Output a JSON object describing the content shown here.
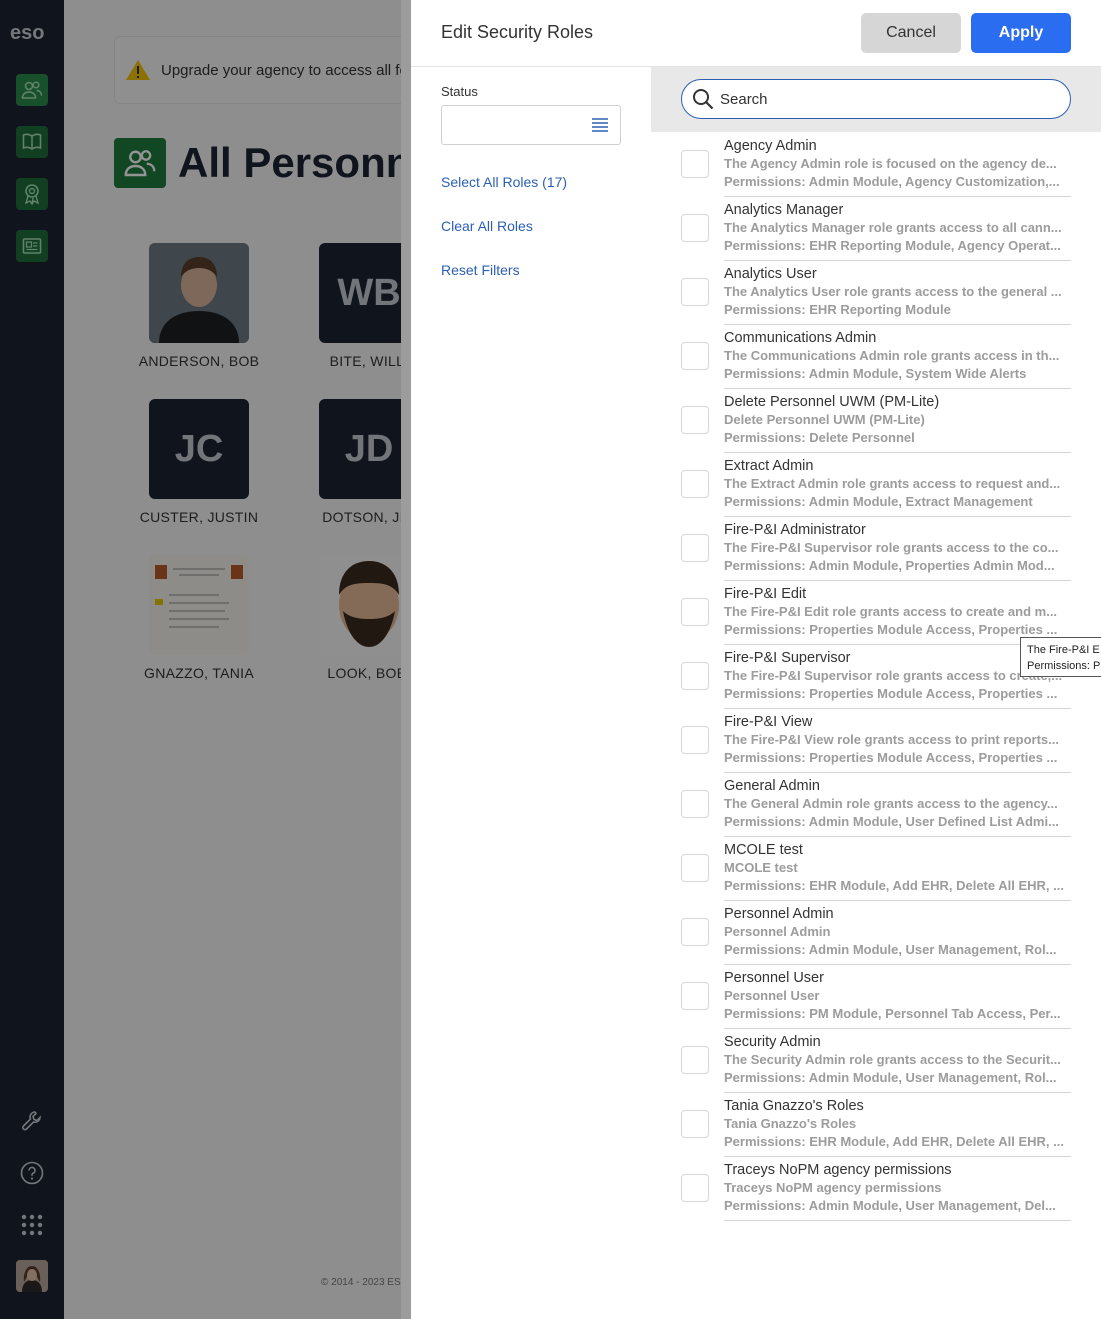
{
  "nav": {
    "logo": "eso",
    "icons": [
      "personnel-icon",
      "book-icon",
      "award-icon",
      "reports-icon"
    ],
    "bottom_icons": [
      "wrench-icon",
      "help-icon",
      "apps-grid-icon"
    ]
  },
  "background": {
    "banner_text": "Upgrade your agency to access all fe",
    "page_title": "All Personn",
    "people": [
      {
        "initials": "",
        "name": "ANDERSON, BOB",
        "photo": true
      },
      {
        "initials": "WB",
        "name": "BITE, WILLI",
        "photo": false
      },
      {
        "initials": "JC",
        "name": "CUSTER, JUSTIN",
        "photo": false
      },
      {
        "initials": "JD",
        "name": "DOTSON, JIM",
        "photo": false
      },
      {
        "initials": "",
        "name": "GNAZZO, TANIA",
        "photo": true
      },
      {
        "initials": "",
        "name": "LOOK, BOBI",
        "photo": true
      }
    ],
    "footer": "© 2014 - 2023 ES"
  },
  "drawer": {
    "title": "Edit Security Roles",
    "cancel_label": "Cancel",
    "apply_label": "Apply",
    "status_label": "Status",
    "select_all_label": "Select All Roles (17)",
    "clear_all_label": "Clear All Roles",
    "reset_filters_label": "Reset Filters",
    "search_placeholder": "Search"
  },
  "roles": [
    {
      "name": "Agency Admin",
      "desc": "The Agency Admin role is focused on the agency de...",
      "perms": "Permissions: Admin Module, Agency Customization,..."
    },
    {
      "name": "Analytics Manager",
      "desc": "The Analytics Manager role grants access to all cann...",
      "perms": "Permissions: EHR Reporting Module, Agency Operat..."
    },
    {
      "name": "Analytics User",
      "desc": "The Analytics User role grants access to the general ...",
      "perms": "Permissions: EHR Reporting Module"
    },
    {
      "name": "Communications Admin",
      "desc": "The Communications Admin role grants access in th...",
      "perms": "Permissions: Admin Module, System Wide Alerts"
    },
    {
      "name": "Delete Personnel UWM (PM-Lite)",
      "desc": "Delete Personnel UWM (PM-Lite)",
      "perms": "Permissions: Delete Personnel"
    },
    {
      "name": "Extract Admin",
      "desc": "The Extract Admin role grants access to request and...",
      "perms": "Permissions: Admin Module, Extract Management"
    },
    {
      "name": "Fire-P&I Administrator",
      "desc": "The Fire-P&I Supervisor role grants access to the co...",
      "perms": "Permissions: Admin Module, Properties Admin Mod..."
    },
    {
      "name": "Fire-P&I Edit",
      "desc": "The Fire-P&I Edit role grants access to create and m...",
      "perms": "Permissions: Properties Module Access, Properties ..."
    },
    {
      "name": "Fire-P&I Supervisor",
      "desc": "The Fire-P&I Supervisor role grants access to create,...",
      "perms": "Permissions: Properties Module Access, Properties ..."
    },
    {
      "name": "Fire-P&I View",
      "desc": "The Fire-P&I View role grants access to print reports...",
      "perms": "Permissions: Properties Module Access, Properties ..."
    },
    {
      "name": "General Admin",
      "desc": "The General Admin role grants access to the agency...",
      "perms": "Permissions: Admin Module, User Defined List Admi..."
    },
    {
      "name": "MCOLE test",
      "desc": "MCOLE test",
      "perms": "Permissions: EHR Module, Add EHR, Delete All EHR, ..."
    },
    {
      "name": "Personnel Admin",
      "desc": "Personnel Admin",
      "perms": "Permissions: Admin Module, User Management, Rol..."
    },
    {
      "name": "Personnel User",
      "desc": "Personnel User",
      "perms": "Permissions: PM Module, Personnel Tab Access, Per..."
    },
    {
      "name": "Security Admin",
      "desc": "The Security Admin role grants access to the Securit...",
      "perms": "Permissions: Admin Module, User Management, Rol..."
    },
    {
      "name": "Tania Gnazzo's Roles",
      "desc": "Tania Gnazzo's Roles",
      "perms": "Permissions: EHR Module, Add EHR, Delete All EHR, ..."
    },
    {
      "name": "Traceys NoPM agency permissions",
      "desc": "Traceys NoPM agency permissions",
      "perms": "Permissions: Admin Module, User Management, Del..."
    }
  ],
  "tooltip": {
    "line1": "The Fire-P&I E",
    "line2": "Permissions: P"
  }
}
